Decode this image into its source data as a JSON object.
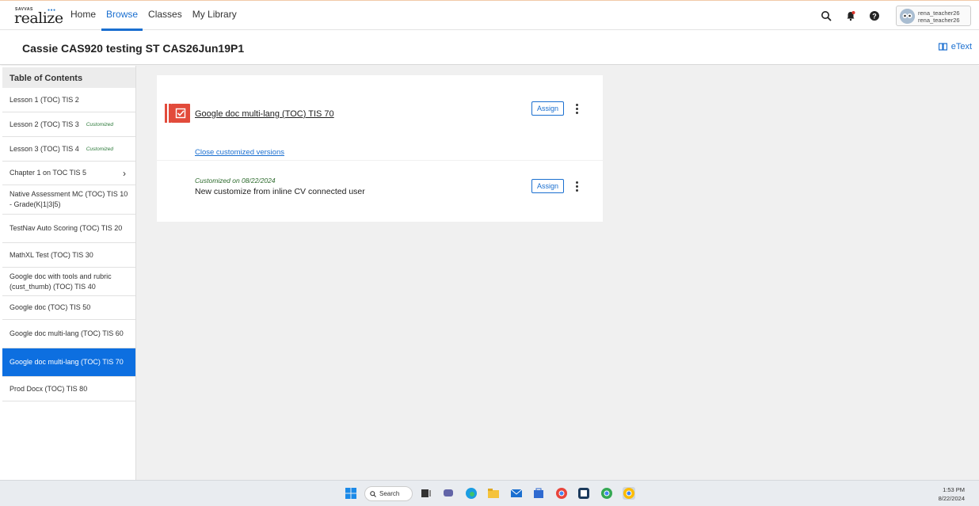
{
  "app": {
    "logo_small": "SAVVAS",
    "logo_text": "realize",
    "logo_dots": "●●●"
  },
  "nav": {
    "links": [
      "Home",
      "Browse",
      "Classes",
      "My Library"
    ],
    "active": "Browse"
  },
  "user": {
    "line1": "rena_teacher26",
    "line2": "rena_teacher26"
  },
  "title_bar": {
    "title": "Cassie CAS920 testing ST CAS26Jun19P1",
    "etext_label": "eText"
  },
  "sidebar": {
    "heading": "Table of Contents",
    "items": [
      {
        "label": "Lesson 1 (TOC) TIS 2",
        "badge": "",
        "chevron": false,
        "active": false
      },
      {
        "label": "Lesson 2 (TOC) TIS 3",
        "badge": "Customized",
        "chevron": false,
        "active": false
      },
      {
        "label": "Lesson 3 (TOC) TIS 4",
        "badge": "Customized",
        "chevron": false,
        "active": false
      },
      {
        "label": "Chapter 1 on TOC TIS 5",
        "badge": "",
        "chevron": true,
        "active": false
      },
      {
        "label": "Native Assessment MC (TOC) TIS 10 - Grade(K|1|3|5)",
        "badge": "",
        "chevron": false,
        "active": false
      },
      {
        "label": "TestNav Auto Scoring (TOC) TIS 20",
        "badge": "",
        "chevron": false,
        "active": false
      },
      {
        "label": "MathXL Test (TOC) TIS 30",
        "badge": "",
        "chevron": false,
        "active": false
      },
      {
        "label": "Google doc with tools and rubric (cust_thumb) (TOC) TIS 40",
        "badge": "",
        "chevron": false,
        "active": false
      },
      {
        "label": "Google doc (TOC) TIS 50",
        "badge": "",
        "chevron": false,
        "active": false
      },
      {
        "label": "Google doc multi-lang (TOC) TIS 60",
        "badge": "",
        "chevron": false,
        "active": false
      },
      {
        "label": "Google doc multi-lang (TOC) TIS 70",
        "badge": "",
        "chevron": false,
        "active": true
      },
      {
        "label": "Prod Docx (TOC) TIS 80",
        "badge": "",
        "chevron": false,
        "active": false
      }
    ]
  },
  "resource": {
    "title": "Google doc multi-lang (TOC) TIS 70",
    "assign_label": "Assign",
    "close_versions_label": "Close customized versions"
  },
  "customized_version": {
    "date_label": "Customized on 08/22/2024",
    "title": "New customize from inline CV connected user",
    "assign_label": "Assign"
  },
  "taskbar": {
    "search_label": "Search",
    "time": "1:53 PM",
    "date": "8/22/2024"
  },
  "colors": {
    "accent": "#1a6fd0",
    "active_item": "#0d6fe0",
    "resource_icon": "#e24b3b",
    "customized_badge": "#2c7a3a"
  }
}
